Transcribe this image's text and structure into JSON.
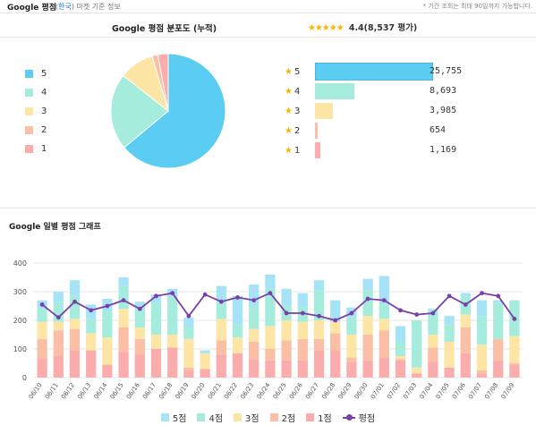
{
  "header": {
    "title": "Google 평점",
    "region_prefix": "(",
    "region": "한국",
    "region_suffix": ") 마켓 기준 정보",
    "note": "* 기간 조회는 최대 90일까지 가능합니다."
  },
  "distribution": {
    "title": "Google 평점 분포도 (누적)",
    "rating_text": "4.4(8,537 평가)",
    "stars": "★★★★★",
    "items": [
      {
        "label": "5",
        "count": 25755,
        "display": "25,755",
        "color": "#5bcdf3"
      },
      {
        "label": "4",
        "count": 8693,
        "display": "8,693",
        "color": "#a6ecdc"
      },
      {
        "label": "3",
        "count": 3985,
        "display": "3,985",
        "color": "#fde5a5"
      },
      {
        "label": "2",
        "count": 654,
        "display": "654",
        "color": "#fbbfa6"
      },
      {
        "label": "1",
        "count": 1169,
        "display": "1,169",
        "color": "#fbadad"
      }
    ],
    "bar_star": "★"
  },
  "daily": {
    "title": "Google 일별 평점 그래프"
  },
  "chart_data": {
    "type": "bar",
    "stacked": true,
    "categories": [
      "06/10",
      "06/11",
      "06/12",
      "06/13",
      "06/14",
      "06/15",
      "06/16",
      "06/17",
      "06/18",
      "06/19",
      "06/20",
      "06/21",
      "06/22",
      "06/23",
      "06/24",
      "06/25",
      "06/26",
      "06/27",
      "06/28",
      "06/29",
      "06/30",
      "07/01",
      "07/02",
      "07/03",
      "07/04",
      "07/05",
      "07/06",
      "07/07",
      "07/08",
      "07/09"
    ],
    "ylim": [
      0,
      400
    ],
    "yticks": [
      0,
      100,
      200,
      300,
      400
    ],
    "grid": true,
    "legend_position": "bottom",
    "series": [
      {
        "name": "1점",
        "color": "#fbadad",
        "values": [
          65,
          75,
          95,
          95,
          45,
          90,
          80,
          100,
          105,
          25,
          30,
          80,
          85,
          65,
          60,
          60,
          60,
          95,
          95,
          55,
          60,
          70,
          60,
          15,
          55,
          35,
          85,
          15,
          60,
          45
        ]
      },
      {
        "name": "2점",
        "color": "#fbbfa6",
        "values": [
          70,
          90,
          75,
          0,
          0,
          85,
          55,
          0,
          0,
          10,
          0,
          50,
          0,
          60,
          40,
          70,
          75,
          40,
          60,
          15,
          90,
          95,
          5,
          0,
          50,
          0,
          90,
          10,
          75,
          5
        ]
      },
      {
        "name": "3점",
        "color": "#fde5a5",
        "values": [
          60,
          30,
          35,
          60,
          95,
          65,
          40,
          50,
          45,
          100,
          55,
          75,
          55,
          45,
          80,
          70,
          60,
          65,
          40,
          80,
          65,
          40,
          10,
          20,
          45,
          90,
          45,
          90,
          0,
          95
        ]
      },
      {
        "name": "4점",
        "color": "#a6ecdc",
        "values": [
          50,
          70,
          80,
          50,
          90,
          80,
          65,
          110,
          130,
          40,
          0,
          60,
          45,
          80,
          130,
          50,
          50,
          105,
          0,
          60,
          90,
          50,
          50,
          165,
          80,
          60,
          65,
          100,
          125,
          125
        ]
      },
      {
        "name": "5점",
        "color": "#a7e3f7",
        "values": [
          25,
          35,
          55,
          50,
          45,
          30,
          25,
          30,
          30,
          35,
          10,
          55,
          100,
          75,
          50,
          60,
          50,
          35,
          75,
          35,
          40,
          100,
          55,
          0,
          10,
          30,
          10,
          55,
          10,
          0
        ]
      }
    ],
    "line": {
      "name": "평점",
      "color": "#7b3fa8",
      "values": [
        255,
        210,
        265,
        235,
        250,
        270,
        240,
        285,
        295,
        215,
        290,
        265,
        280,
        270,
        295,
        225,
        225,
        215,
        200,
        225,
        275,
        270,
        235,
        220,
        225,
        285,
        255,
        295,
        285,
        205
      ]
    },
    "legend": [
      "5점",
      "4점",
      "3점",
      "2점",
      "1점",
      "평점"
    ]
  }
}
